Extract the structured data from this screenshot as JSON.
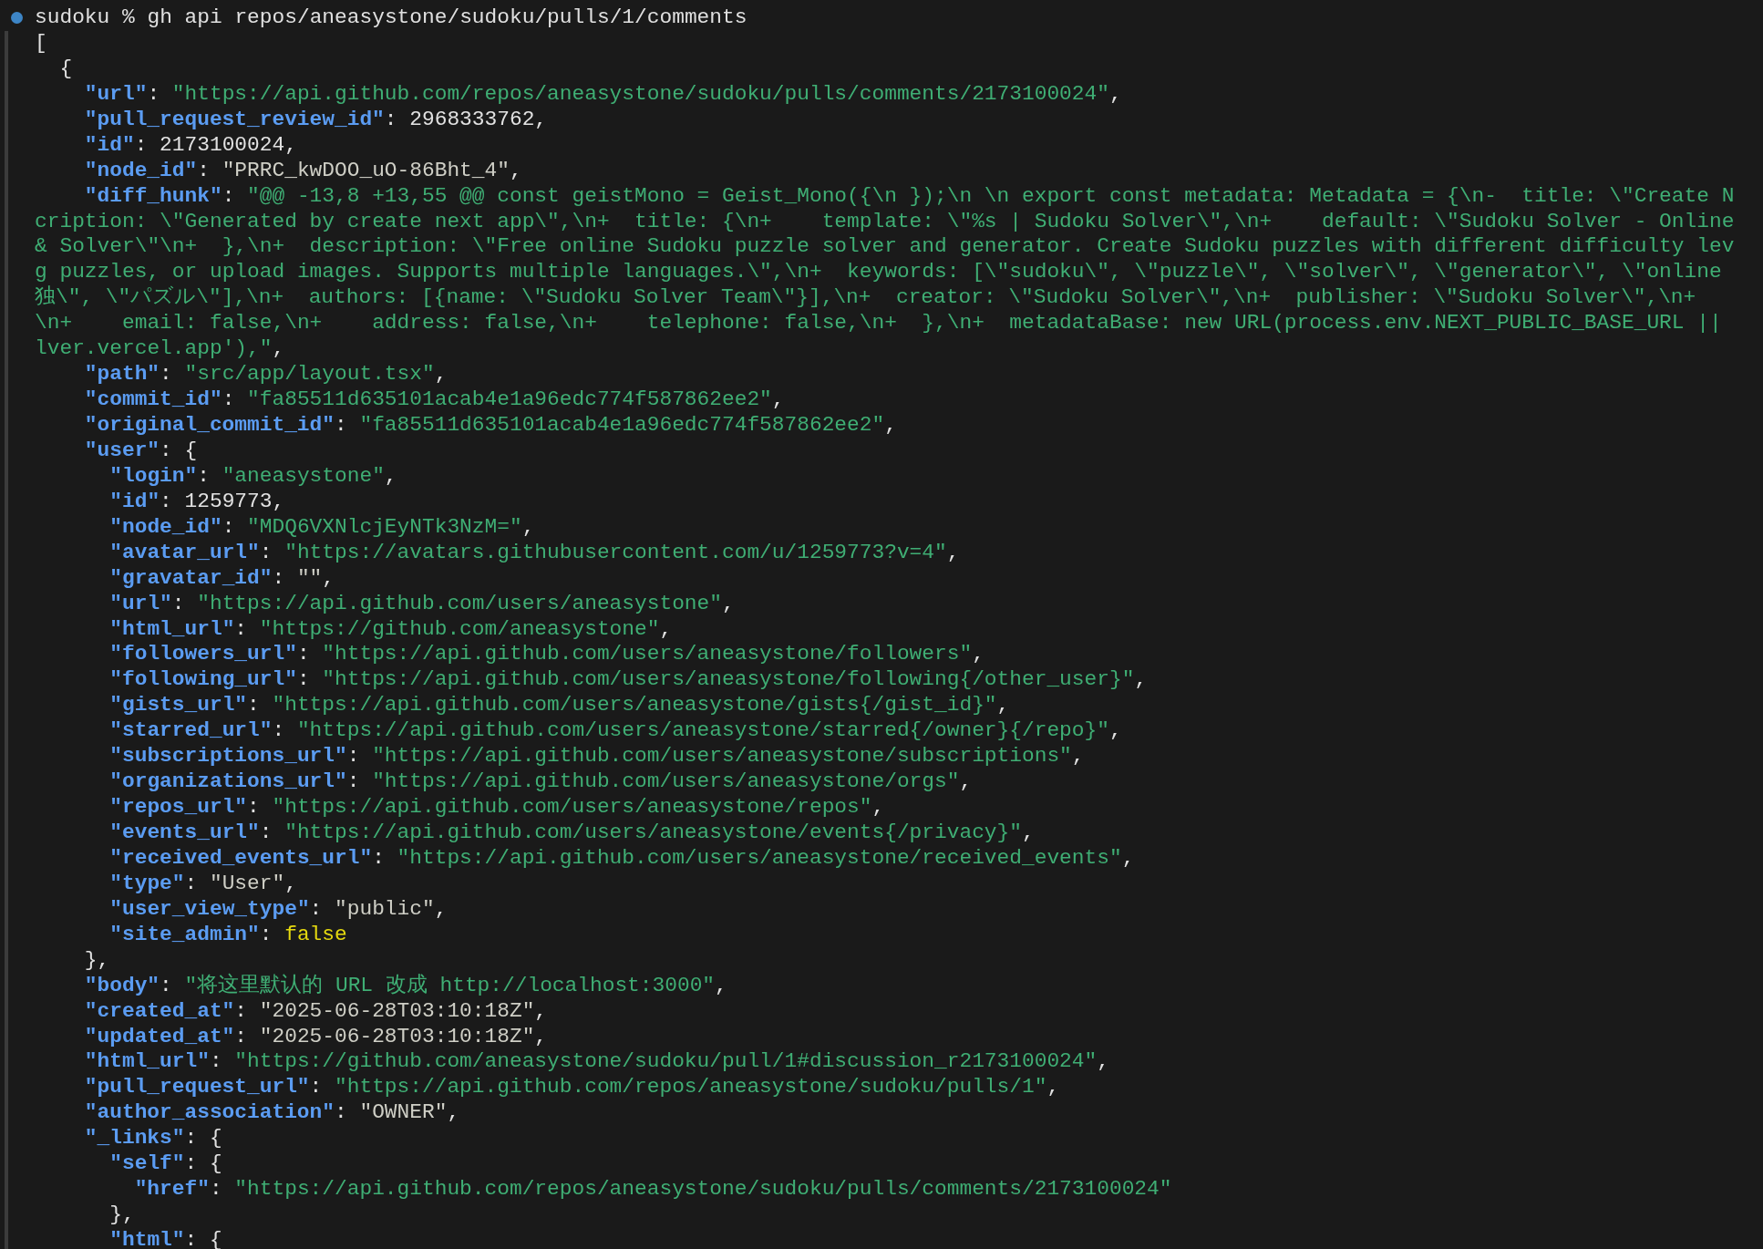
{
  "prompt": {
    "directory": "sudoku",
    "symbol": "%",
    "command": "gh api repos/aneasystone/sudoku/pulls/1/comments"
  },
  "output": [
    {
      "tokens": [
        {
          "kind": "punct",
          "text": "["
        }
      ],
      "children": [
        {
          "tokens": [
            {
              "kind": "punct",
              "text": "{"
            }
          ],
          "children": [
            {
              "tokens": [
                {
                  "kind": "key",
                  "text": "\"url\""
                },
                {
                  "kind": "punct",
                  "text": ": "
                },
                {
                  "kind": "string",
                  "text": "\"https://api.github.com/repos/aneasystone/sudoku/pulls/comments/2173100024\""
                },
                {
                  "kind": "punct",
                  "text": ","
                }
              ]
            },
            {
              "tokens": [
                {
                  "kind": "key",
                  "text": "\"pull_request_review_id\""
                },
                {
                  "kind": "punct",
                  "text": ": "
                },
                {
                  "kind": "number",
                  "text": "2968333762"
                },
                {
                  "kind": "punct",
                  "text": ","
                }
              ]
            },
            {
              "tokens": [
                {
                  "kind": "key",
                  "text": "\"id\""
                },
                {
                  "kind": "punct",
                  "text": ": "
                },
                {
                  "kind": "number",
                  "text": "2173100024"
                },
                {
                  "kind": "punct",
                  "text": ","
                }
              ]
            },
            {
              "tokens": [
                {
                  "kind": "key",
                  "text": "\"node_id\""
                },
                {
                  "kind": "punct",
                  "text": ": "
                },
                {
                  "kind": "text",
                  "text": "\"PRRC_kwDOO_uO-86Bht_4\""
                },
                {
                  "kind": "punct",
                  "text": ","
                }
              ]
            },
            {
              "tokens": [
                {
                  "kind": "key",
                  "text": "\"diff_hunk\""
                },
                {
                  "kind": "punct",
                  "text": ": "
                },
                {
                  "kind": "string",
                  "text": "\"@@ -13,8 +13,55 @@ const geistMono = Geist_Mono({\\n });\\n \\n export const metadata: Metadata = {\\n-  title: \\\"Create N"
                }
              ],
              "continuation": [
                {
                  "tokens": [
                    {
                      "kind": "string",
                      "text": "cription: \\\"Generated by create next app\\\",\\n+  title: {\\n+    template: \\\"%s | Sudoku Solver\\\",\\n+    default: \\\"Sudoku Solver - Online"
                    }
                  ]
                },
                {
                  "tokens": [
                    {
                      "kind": "string",
                      "text": "& Solver\\\"\\n+  },\\n+  description: \\\"Free online Sudoku puzzle solver and generator. Create Sudoku puzzles with different difficulty lev"
                    }
                  ]
                },
                {
                  "tokens": [
                    {
                      "kind": "string",
                      "text": "g puzzles, or upload images. Supports multiple languages.\\\",\\n+  keywords: [\\\"sudoku\\\", \\\"puzzle\\\", \\\"solver\\\", \\\"generator\\\", \\\"online"
                    }
                  ]
                },
                {
                  "tokens": [
                    {
                      "kind": "string",
                      "text": "独\\\", \\\"パズル\\\"],\\n+  authors: [{name: \\\"Sudoku Solver Team\\\"}],\\n+  creator: \\\"Sudoku Solver\\\",\\n+  publisher: \\\"Sudoku Solver\\\",\\n+"
                    }
                  ]
                },
                {
                  "tokens": [
                    {
                      "kind": "string",
                      "text": "\\n+    email: false,\\n+    address: false,\\n+    telephone: false,\\n+  },\\n+  metadataBase: new URL(process.env.NEXT_PUBLIC_BASE_URL ||"
                    }
                  ]
                },
                {
                  "tokens": [
                    {
                      "kind": "string",
                      "text": "lver.vercel.app'),\""
                    },
                    {
                      "kind": "punct",
                      "text": ","
                    }
                  ]
                }
              ]
            },
            {
              "tokens": [
                {
                  "kind": "key",
                  "text": "\"path\""
                },
                {
                  "kind": "punct",
                  "text": ": "
                },
                {
                  "kind": "string",
                  "text": "\"src/app/layout.tsx\""
                },
                {
                  "kind": "punct",
                  "text": ","
                }
              ]
            },
            {
              "tokens": [
                {
                  "kind": "key",
                  "text": "\"commit_id\""
                },
                {
                  "kind": "punct",
                  "text": ": "
                },
                {
                  "kind": "string",
                  "text": "\"fa85511d635101acab4e1a96edc774f587862ee2\""
                },
                {
                  "kind": "punct",
                  "text": ","
                }
              ]
            },
            {
              "tokens": [
                {
                  "kind": "key",
                  "text": "\"original_commit_id\""
                },
                {
                  "kind": "punct",
                  "text": ": "
                },
                {
                  "kind": "string",
                  "text": "\"fa85511d635101acab4e1a96edc774f587862ee2\""
                },
                {
                  "kind": "punct",
                  "text": ","
                }
              ]
            },
            {
              "tokens": [
                {
                  "kind": "key",
                  "text": "\"user\""
                },
                {
                  "kind": "punct",
                  "text": ": {"
                }
              ],
              "children": [
                {
                  "tokens": [
                    {
                      "kind": "key",
                      "text": "\"login\""
                    },
                    {
                      "kind": "punct",
                      "text": ": "
                    },
                    {
                      "kind": "string",
                      "text": "\"aneasystone\""
                    },
                    {
                      "kind": "punct",
                      "text": ","
                    }
                  ]
                },
                {
                  "tokens": [
                    {
                      "kind": "key",
                      "text": "\"id\""
                    },
                    {
                      "kind": "punct",
                      "text": ": "
                    },
                    {
                      "kind": "number",
                      "text": "1259773"
                    },
                    {
                      "kind": "punct",
                      "text": ","
                    }
                  ]
                },
                {
                  "tokens": [
                    {
                      "kind": "key",
                      "text": "\"node_id\""
                    },
                    {
                      "kind": "punct",
                      "text": ": "
                    },
                    {
                      "kind": "string",
                      "text": "\"MDQ6VXNlcjEyNTk3NzM=\""
                    },
                    {
                      "kind": "punct",
                      "text": ","
                    }
                  ]
                },
                {
                  "tokens": [
                    {
                      "kind": "key",
                      "text": "\"avatar_url\""
                    },
                    {
                      "kind": "punct",
                      "text": ": "
                    },
                    {
                      "kind": "string",
                      "text": "\"https://avatars.githubusercontent.com/u/1259773?v=4\""
                    },
                    {
                      "kind": "punct",
                      "text": ","
                    }
                  ]
                },
                {
                  "tokens": [
                    {
                      "kind": "key",
                      "text": "\"gravatar_id\""
                    },
                    {
                      "kind": "punct",
                      "text": ": "
                    },
                    {
                      "kind": "text",
                      "text": "\"\""
                    },
                    {
                      "kind": "punct",
                      "text": ","
                    }
                  ]
                },
                {
                  "tokens": [
                    {
                      "kind": "key",
                      "text": "\"url\""
                    },
                    {
                      "kind": "punct",
                      "text": ": "
                    },
                    {
                      "kind": "string",
                      "text": "\"https://api.github.com/users/aneasystone\""
                    },
                    {
                      "kind": "punct",
                      "text": ","
                    }
                  ]
                },
                {
                  "tokens": [
                    {
                      "kind": "key",
                      "text": "\"html_url\""
                    },
                    {
                      "kind": "punct",
                      "text": ": "
                    },
                    {
                      "kind": "string",
                      "text": "\"https://github.com/aneasystone\""
                    },
                    {
                      "kind": "punct",
                      "text": ","
                    }
                  ]
                },
                {
                  "tokens": [
                    {
                      "kind": "key",
                      "text": "\"followers_url\""
                    },
                    {
                      "kind": "punct",
                      "text": ": "
                    },
                    {
                      "kind": "string",
                      "text": "\"https://api.github.com/users/aneasystone/followers\""
                    },
                    {
                      "kind": "punct",
                      "text": ","
                    }
                  ]
                },
                {
                  "tokens": [
                    {
                      "kind": "key",
                      "text": "\"following_url\""
                    },
                    {
                      "kind": "punct",
                      "text": ": "
                    },
                    {
                      "kind": "string",
                      "text": "\"https://api.github.com/users/aneasystone/following{/other_user}\""
                    },
                    {
                      "kind": "punct",
                      "text": ","
                    }
                  ]
                },
                {
                  "tokens": [
                    {
                      "kind": "key",
                      "text": "\"gists_url\""
                    },
                    {
                      "kind": "punct",
                      "text": ": "
                    },
                    {
                      "kind": "string",
                      "text": "\"https://api.github.com/users/aneasystone/gists{/gist_id}\""
                    },
                    {
                      "kind": "punct",
                      "text": ","
                    }
                  ]
                },
                {
                  "tokens": [
                    {
                      "kind": "key",
                      "text": "\"starred_url\""
                    },
                    {
                      "kind": "punct",
                      "text": ": "
                    },
                    {
                      "kind": "string",
                      "text": "\"https://api.github.com/users/aneasystone/starred{/owner}{/repo}\""
                    },
                    {
                      "kind": "punct",
                      "text": ","
                    }
                  ]
                },
                {
                  "tokens": [
                    {
                      "kind": "key",
                      "text": "\"subscriptions_url\""
                    },
                    {
                      "kind": "punct",
                      "text": ": "
                    },
                    {
                      "kind": "string",
                      "text": "\"https://api.github.com/users/aneasystone/subscriptions\""
                    },
                    {
                      "kind": "punct",
                      "text": ","
                    }
                  ]
                },
                {
                  "tokens": [
                    {
                      "kind": "key",
                      "text": "\"organizations_url\""
                    },
                    {
                      "kind": "punct",
                      "text": ": "
                    },
                    {
                      "kind": "string",
                      "text": "\"https://api.github.com/users/aneasystone/orgs\""
                    },
                    {
                      "kind": "punct",
                      "text": ","
                    }
                  ]
                },
                {
                  "tokens": [
                    {
                      "kind": "key",
                      "text": "\"repos_url\""
                    },
                    {
                      "kind": "punct",
                      "text": ": "
                    },
                    {
                      "kind": "string",
                      "text": "\"https://api.github.com/users/aneasystone/repos\""
                    },
                    {
                      "kind": "punct",
                      "text": ","
                    }
                  ]
                },
                {
                  "tokens": [
                    {
                      "kind": "key",
                      "text": "\"events_url\""
                    },
                    {
                      "kind": "punct",
                      "text": ": "
                    },
                    {
                      "kind": "string",
                      "text": "\"https://api.github.com/users/aneasystone/events{/privacy}\""
                    },
                    {
                      "kind": "punct",
                      "text": ","
                    }
                  ]
                },
                {
                  "tokens": [
                    {
                      "kind": "key",
                      "text": "\"received_events_url\""
                    },
                    {
                      "kind": "punct",
                      "text": ": "
                    },
                    {
                      "kind": "string",
                      "text": "\"https://api.github.com/users/aneasystone/received_events\""
                    },
                    {
                      "kind": "punct",
                      "text": ","
                    }
                  ]
                },
                {
                  "tokens": [
                    {
                      "kind": "key",
                      "text": "\"type\""
                    },
                    {
                      "kind": "punct",
                      "text": ": "
                    },
                    {
                      "kind": "text",
                      "text": "\"User\""
                    },
                    {
                      "kind": "punct",
                      "text": ","
                    }
                  ]
                },
                {
                  "tokens": [
                    {
                      "kind": "key",
                      "text": "\"user_view_type\""
                    },
                    {
                      "kind": "punct",
                      "text": ": "
                    },
                    {
                      "kind": "text",
                      "text": "\"public\""
                    },
                    {
                      "kind": "punct",
                      "text": ","
                    }
                  ]
                },
                {
                  "tokens": [
                    {
                      "kind": "key",
                      "text": "\"site_admin\""
                    },
                    {
                      "kind": "punct",
                      "text": ": "
                    },
                    {
                      "kind": "bool",
                      "text": "false"
                    }
                  ]
                }
              ]
            },
            {
              "tokens": [
                {
                  "kind": "punct",
                  "text": "},"
                }
              ]
            },
            {
              "tokens": [
                {
                  "kind": "key",
                  "text": "\"body\""
                },
                {
                  "kind": "punct",
                  "text": ": "
                },
                {
                  "kind": "string",
                  "text": "\"将这里默认的 URL 改成 http://localhost:3000\""
                },
                {
                  "kind": "punct",
                  "text": ","
                }
              ]
            },
            {
              "tokens": [
                {
                  "kind": "key",
                  "text": "\"created_at\""
                },
                {
                  "kind": "punct",
                  "text": ": "
                },
                {
                  "kind": "text",
                  "text": "\"2025-06-28T03:10:18Z\""
                },
                {
                  "kind": "punct",
                  "text": ","
                }
              ]
            },
            {
              "tokens": [
                {
                  "kind": "key",
                  "text": "\"updated_at\""
                },
                {
                  "kind": "punct",
                  "text": ": "
                },
                {
                  "kind": "text",
                  "text": "\"2025-06-28T03:10:18Z\""
                },
                {
                  "kind": "punct",
                  "text": ","
                }
              ]
            },
            {
              "tokens": [
                {
                  "kind": "key",
                  "text": "\"html_url\""
                },
                {
                  "kind": "punct",
                  "text": ": "
                },
                {
                  "kind": "string",
                  "text": "\"https://github.com/aneasystone/sudoku/pull/1#discussion_r2173100024\""
                },
                {
                  "kind": "punct",
                  "text": ","
                }
              ]
            },
            {
              "tokens": [
                {
                  "kind": "key",
                  "text": "\"pull_request_url\""
                },
                {
                  "kind": "punct",
                  "text": ": "
                },
                {
                  "kind": "string",
                  "text": "\"https://api.github.com/repos/aneasystone/sudoku/pulls/1\""
                },
                {
                  "kind": "punct",
                  "text": ","
                }
              ]
            },
            {
              "tokens": [
                {
                  "kind": "key",
                  "text": "\"author_association\""
                },
                {
                  "kind": "punct",
                  "text": ": "
                },
                {
                  "kind": "text",
                  "text": "\"OWNER\""
                },
                {
                  "kind": "punct",
                  "text": ","
                }
              ]
            },
            {
              "tokens": [
                {
                  "kind": "key",
                  "text": "\"_links\""
                },
                {
                  "kind": "punct",
                  "text": ": {"
                }
              ],
              "children": [
                {
                  "tokens": [
                    {
                      "kind": "key",
                      "text": "\"self\""
                    },
                    {
                      "kind": "punct",
                      "text": ": {"
                    }
                  ],
                  "children": [
                    {
                      "tokens": [
                        {
                          "kind": "key",
                          "text": "\"href\""
                        },
                        {
                          "kind": "punct",
                          "text": ": "
                        },
                        {
                          "kind": "string",
                          "text": "\"https://api.github.com/repos/aneasystone/sudoku/pulls/comments/2173100024\""
                        }
                      ]
                    }
                  ]
                },
                {
                  "tokens": [
                    {
                      "kind": "punct",
                      "text": "},"
                    }
                  ]
                },
                {
                  "tokens": [
                    {
                      "kind": "key",
                      "text": "\"html\""
                    },
                    {
                      "kind": "punct",
                      "text": ": {"
                    }
                  ]
                }
              ]
            }
          ]
        }
      ]
    }
  ]
}
